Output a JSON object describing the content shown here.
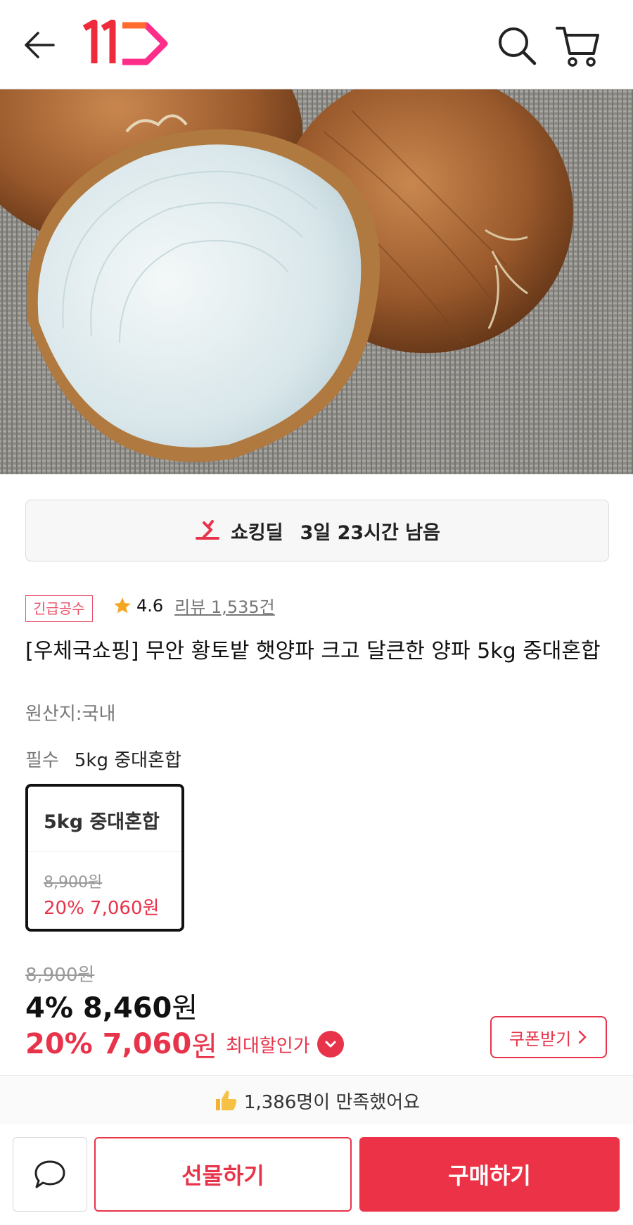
{
  "header": {
    "back_icon": "arrow-left-icon",
    "logo_text": "11",
    "search_icon": "search-icon",
    "cart_icon": "cart-icon"
  },
  "product_image": {
    "description_icon": "onion-photo"
  },
  "deal": {
    "label": "쇼킹딜",
    "time_left": "3일 23시간 남음"
  },
  "product": {
    "badge": "긴급공수",
    "rating": "4.6",
    "reviews": "리뷰 1,535건",
    "title": "[우체국쇼핑] 무안 황토밭 햇양파 크고 달큰한 양파 5kg 중대혼합",
    "origin": "원산지:국내"
  },
  "option": {
    "required_label": "필수",
    "selected_value": "5kg 중대혼합",
    "card": {
      "name": "5kg 중대혼합",
      "original_price": "8,900원",
      "sale_price": "20% 7,060원"
    }
  },
  "price": {
    "original": "8,900원",
    "discount_pct": "4%",
    "discount_amount": "8,460",
    "best_pct": "20%",
    "best_amount": "7,060",
    "won": "원",
    "best_label": "최대할인가"
  },
  "coupon": {
    "label": "쿠폰받기"
  },
  "satisfaction": {
    "text": "1,386명이 만족했어요"
  },
  "actions": {
    "gift": "선물하기",
    "buy": "구매하기"
  },
  "colors": {
    "accent": "#e8344a",
    "badge": "#e8506a",
    "star": "#f5a623"
  }
}
